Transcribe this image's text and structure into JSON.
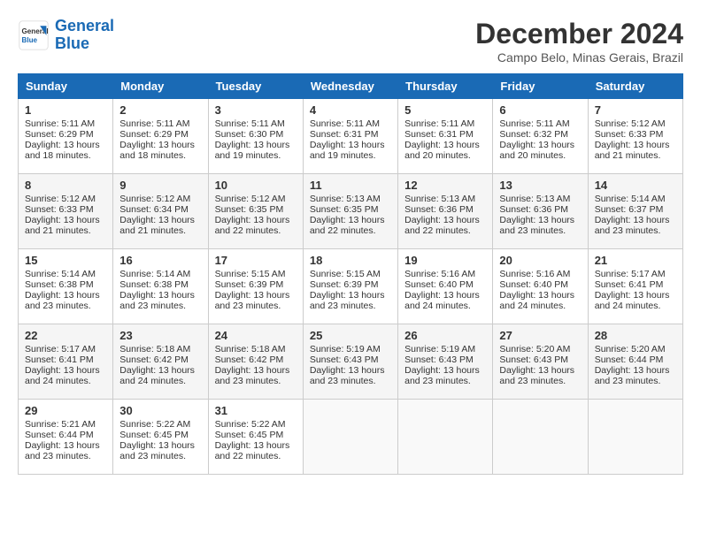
{
  "logo": {
    "name": "General",
    "name2": "Blue"
  },
  "header": {
    "month_year": "December 2024",
    "location": "Campo Belo, Minas Gerais, Brazil"
  },
  "weekdays": [
    "Sunday",
    "Monday",
    "Tuesday",
    "Wednesday",
    "Thursday",
    "Friday",
    "Saturday"
  ],
  "weeks": [
    [
      {
        "day": "1",
        "sunrise": "5:11 AM",
        "sunset": "6:29 PM",
        "daylight": "13 hours and 18 minutes."
      },
      {
        "day": "2",
        "sunrise": "5:11 AM",
        "sunset": "6:29 PM",
        "daylight": "13 hours and 18 minutes."
      },
      {
        "day": "3",
        "sunrise": "5:11 AM",
        "sunset": "6:30 PM",
        "daylight": "13 hours and 19 minutes."
      },
      {
        "day": "4",
        "sunrise": "5:11 AM",
        "sunset": "6:31 PM",
        "daylight": "13 hours and 19 minutes."
      },
      {
        "day": "5",
        "sunrise": "5:11 AM",
        "sunset": "6:31 PM",
        "daylight": "13 hours and 20 minutes."
      },
      {
        "day": "6",
        "sunrise": "5:11 AM",
        "sunset": "6:32 PM",
        "daylight": "13 hours and 20 minutes."
      },
      {
        "day": "7",
        "sunrise": "5:12 AM",
        "sunset": "6:33 PM",
        "daylight": "13 hours and 21 minutes."
      }
    ],
    [
      {
        "day": "8",
        "sunrise": "5:12 AM",
        "sunset": "6:33 PM",
        "daylight": "13 hours and 21 minutes."
      },
      {
        "day": "9",
        "sunrise": "5:12 AM",
        "sunset": "6:34 PM",
        "daylight": "13 hours and 21 minutes."
      },
      {
        "day": "10",
        "sunrise": "5:12 AM",
        "sunset": "6:35 PM",
        "daylight": "13 hours and 22 minutes."
      },
      {
        "day": "11",
        "sunrise": "5:13 AM",
        "sunset": "6:35 PM",
        "daylight": "13 hours and 22 minutes."
      },
      {
        "day": "12",
        "sunrise": "5:13 AM",
        "sunset": "6:36 PM",
        "daylight": "13 hours and 22 minutes."
      },
      {
        "day": "13",
        "sunrise": "5:13 AM",
        "sunset": "6:36 PM",
        "daylight": "13 hours and 23 minutes."
      },
      {
        "day": "14",
        "sunrise": "5:14 AM",
        "sunset": "6:37 PM",
        "daylight": "13 hours and 23 minutes."
      }
    ],
    [
      {
        "day": "15",
        "sunrise": "5:14 AM",
        "sunset": "6:38 PM",
        "daylight": "13 hours and 23 minutes."
      },
      {
        "day": "16",
        "sunrise": "5:14 AM",
        "sunset": "6:38 PM",
        "daylight": "13 hours and 23 minutes."
      },
      {
        "day": "17",
        "sunrise": "5:15 AM",
        "sunset": "6:39 PM",
        "daylight": "13 hours and 23 minutes."
      },
      {
        "day": "18",
        "sunrise": "5:15 AM",
        "sunset": "6:39 PM",
        "daylight": "13 hours and 23 minutes."
      },
      {
        "day": "19",
        "sunrise": "5:16 AM",
        "sunset": "6:40 PM",
        "daylight": "13 hours and 24 minutes."
      },
      {
        "day": "20",
        "sunrise": "5:16 AM",
        "sunset": "6:40 PM",
        "daylight": "13 hours and 24 minutes."
      },
      {
        "day": "21",
        "sunrise": "5:17 AM",
        "sunset": "6:41 PM",
        "daylight": "13 hours and 24 minutes."
      }
    ],
    [
      {
        "day": "22",
        "sunrise": "5:17 AM",
        "sunset": "6:41 PM",
        "daylight": "13 hours and 24 minutes."
      },
      {
        "day": "23",
        "sunrise": "5:18 AM",
        "sunset": "6:42 PM",
        "daylight": "13 hours and 24 minutes."
      },
      {
        "day": "24",
        "sunrise": "5:18 AM",
        "sunset": "6:42 PM",
        "daylight": "13 hours and 23 minutes."
      },
      {
        "day": "25",
        "sunrise": "5:19 AM",
        "sunset": "6:43 PM",
        "daylight": "13 hours and 23 minutes."
      },
      {
        "day": "26",
        "sunrise": "5:19 AM",
        "sunset": "6:43 PM",
        "daylight": "13 hours and 23 minutes."
      },
      {
        "day": "27",
        "sunrise": "5:20 AM",
        "sunset": "6:43 PM",
        "daylight": "13 hours and 23 minutes."
      },
      {
        "day": "28",
        "sunrise": "5:20 AM",
        "sunset": "6:44 PM",
        "daylight": "13 hours and 23 minutes."
      }
    ],
    [
      {
        "day": "29",
        "sunrise": "5:21 AM",
        "sunset": "6:44 PM",
        "daylight": "13 hours and 23 minutes."
      },
      {
        "day": "30",
        "sunrise": "5:22 AM",
        "sunset": "6:45 PM",
        "daylight": "13 hours and 23 minutes."
      },
      {
        "day": "31",
        "sunrise": "5:22 AM",
        "sunset": "6:45 PM",
        "daylight": "13 hours and 22 minutes."
      },
      null,
      null,
      null,
      null
    ]
  ]
}
